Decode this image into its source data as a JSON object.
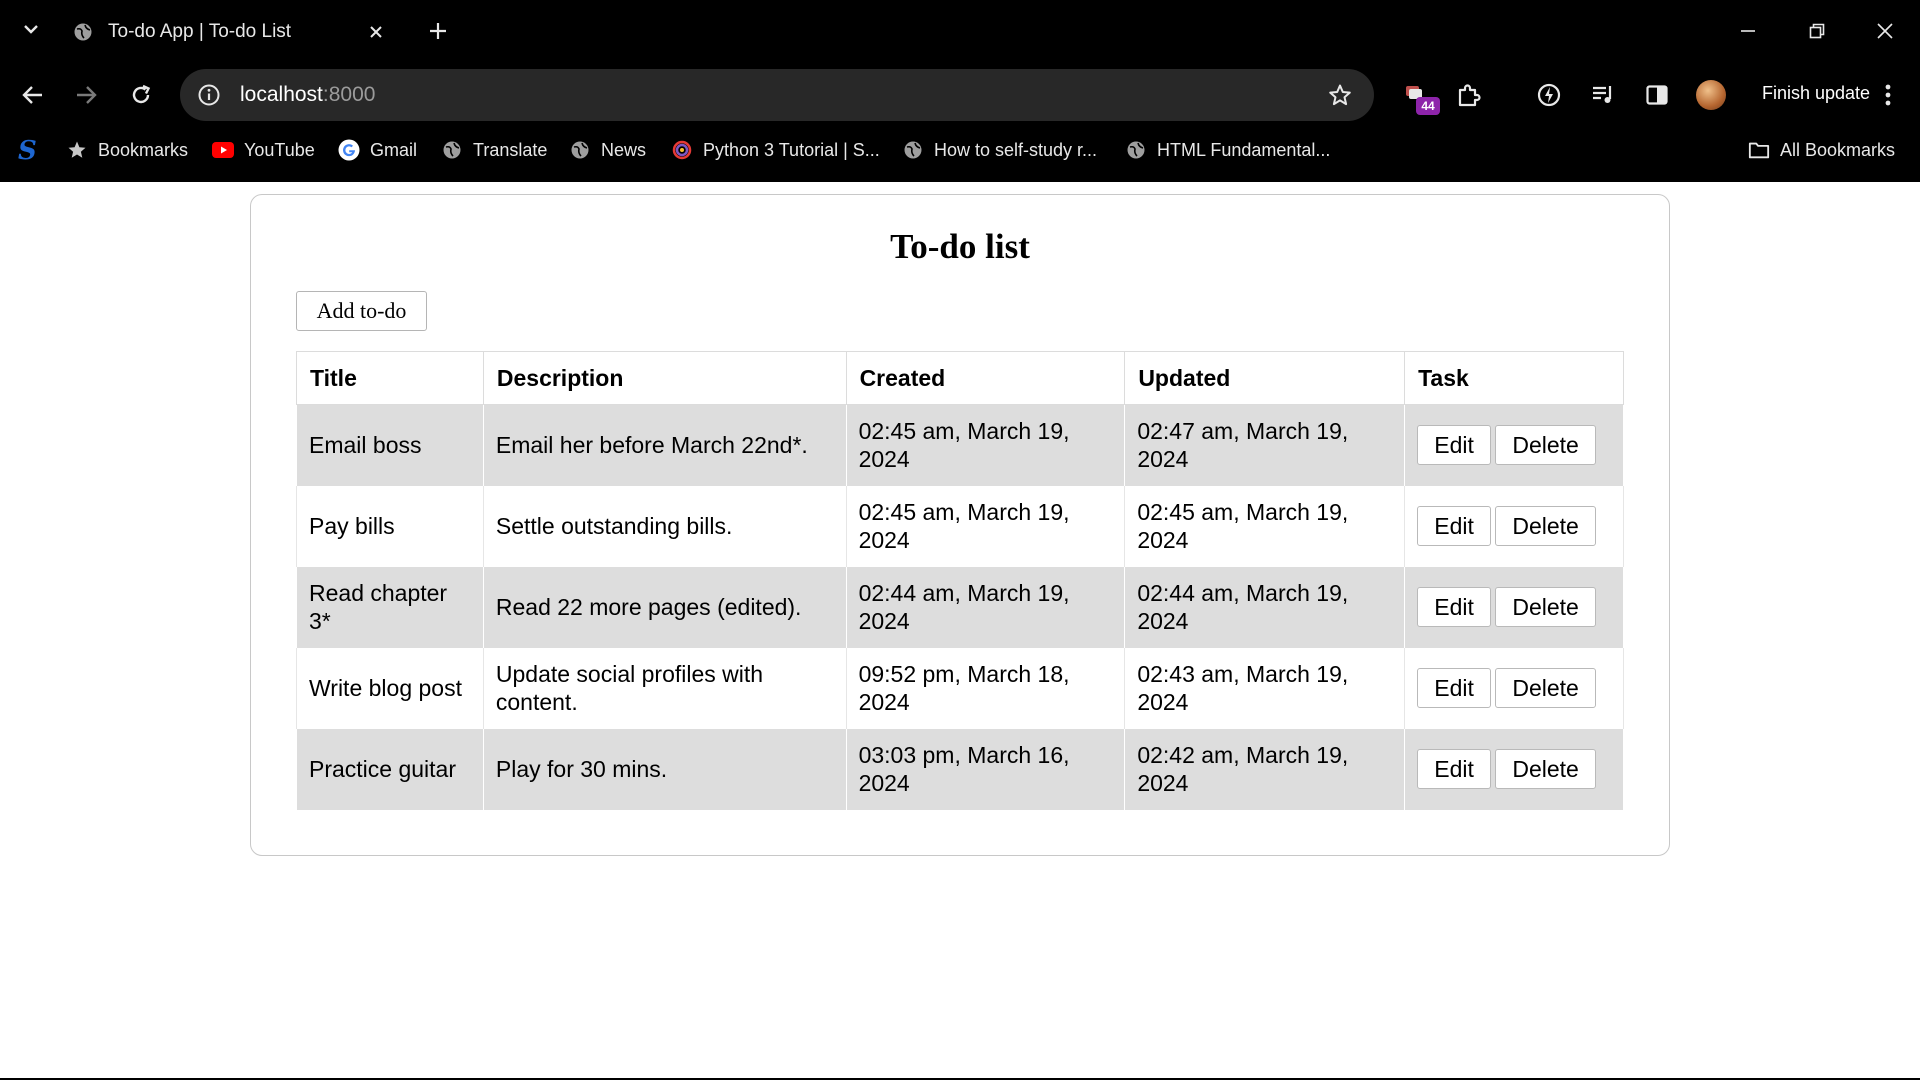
{
  "browser": {
    "tab_title": "To-do App | To-do List",
    "url_host": "localhost",
    "url_port": ":8000",
    "finish_update_label": "Finish update",
    "extension_badge": "44",
    "bookmarks": [
      {
        "label": "Bookmarks",
        "icon": "star-icon"
      },
      {
        "label": "YouTube",
        "icon": "youtube-icon"
      },
      {
        "label": "Gmail",
        "icon": "google-icon"
      },
      {
        "label": "Translate",
        "icon": "globe-icon"
      },
      {
        "label": "News",
        "icon": "globe-icon"
      },
      {
        "label": "Python 3 Tutorial | S...",
        "icon": "swirl-icon"
      },
      {
        "label": "How to self-study r...",
        "icon": "globe-icon"
      },
      {
        "label": "HTML Fundamental...",
        "icon": "globe-icon"
      }
    ],
    "all_bookmarks_label": "All Bookmarks",
    "brand_logo_letter": "S"
  },
  "page": {
    "title": "To-do list",
    "add_button_label": "Add to-do",
    "columns": [
      "Title",
      "Description",
      "Created",
      "Updated",
      "Task"
    ],
    "rows": [
      {
        "title": "Email boss",
        "description": "Email her before March 22nd*.",
        "created": "02:45 am, March 19, 2024",
        "updated": "02:47 am, March 19, 2024"
      },
      {
        "title": "Pay bills",
        "description": "Settle outstanding bills.",
        "created": "02:45 am, March 19, 2024",
        "updated": "02:45 am, March 19, 2024"
      },
      {
        "title": "Read chapter 3*",
        "description": "Read 22 more pages (edited).",
        "created": "02:44 am, March 19, 2024",
        "updated": "02:44 am, March 19, 2024"
      },
      {
        "title": "Write blog post",
        "description": "Update social profiles with content.",
        "created": "09:52 pm, March 18, 2024",
        "updated": "02:43 am, March 19, 2024"
      },
      {
        "title": "Practice guitar",
        "description": "Play for 30 mins.",
        "created": "03:03 pm, March 16, 2024",
        "updated": "02:42 am, March 19, 2024"
      }
    ],
    "edit_label": "Edit",
    "delete_label": "Delete"
  },
  "colors": {
    "chrome_bg": "#000000",
    "omnibox_bg": "#282828",
    "row_shade": "#dddddd",
    "badge": "#8e24aa"
  }
}
